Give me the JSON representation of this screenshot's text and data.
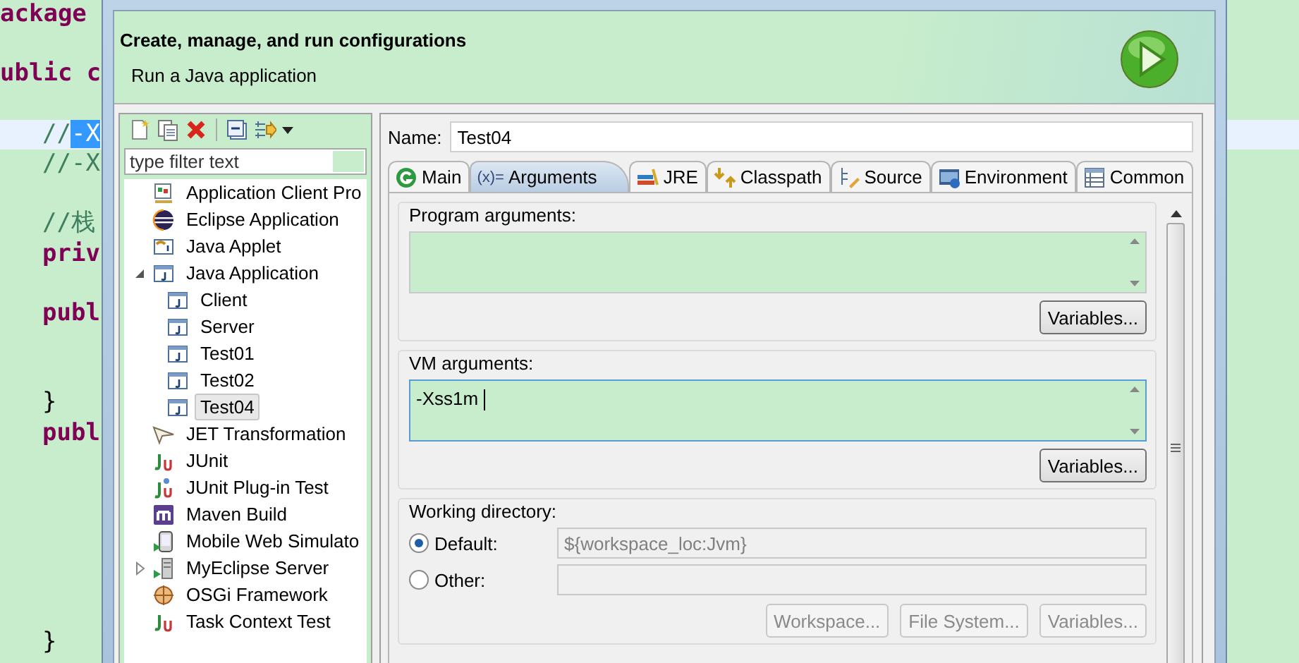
{
  "editor": {
    "lines": [
      {
        "segments": [
          {
            "text": "ackage",
            "kind": "keyword",
            "selected": false
          }
        ]
      },
      {
        "segments": [
          {
            "text": "ublic c",
            "kind": "keyword",
            "selected": false
          }
        ]
      },
      {
        "current": true,
        "segments": [
          {
            "text": "//",
            "kind": "comment",
            "selected": false
          },
          {
            "text": "-X",
            "kind": "comment",
            "selected": true
          }
        ]
      },
      {
        "segments": [
          {
            "text": "//-X",
            "kind": "comment",
            "selected": false
          }
        ]
      },
      {
        "segments": [
          {
            "text": "//栈",
            "kind": "comment",
            "selected": false
          }
        ]
      },
      {
        "segments": [
          {
            "text": "priv",
            "kind": "keyword",
            "selected": false
          }
        ]
      },
      {
        "segments": [
          {
            "text": "publ",
            "kind": "keyword",
            "selected": false
          }
        ]
      },
      {
        "segments": [
          {
            "text": "}",
            "kind": "plain",
            "selected": false
          }
        ]
      },
      {
        "segments": [
          {
            "text": "publ",
            "kind": "keyword",
            "selected": false
          }
        ]
      },
      {
        "segments": [
          {
            "text": "}",
            "kind": "plain",
            "selected": false
          }
        ]
      }
    ]
  },
  "dialog": {
    "title": "Create, manage, and run configurations",
    "subtitle": "Run a Java application",
    "filter": {
      "placeholder": "type filter text"
    },
    "tree": [
      {
        "label": "Application Client Pro"
      },
      {
        "label": "Eclipse Application"
      },
      {
        "label": "Java Applet"
      },
      {
        "label": "Java Application",
        "expanded": true,
        "children": [
          {
            "label": "Client",
            "selected": false
          },
          {
            "label": "Server",
            "selected": false
          },
          {
            "label": "Test01",
            "selected": false
          },
          {
            "label": "Test02",
            "selected": false
          },
          {
            "label": "Test04",
            "selected": true
          }
        ]
      },
      {
        "label": "JET Transformation"
      },
      {
        "label": "JUnit"
      },
      {
        "label": "JUnit Plug-in Test"
      },
      {
        "label": "Maven Build"
      },
      {
        "label": "Mobile Web Simulato"
      },
      {
        "label": "MyEclipse Server",
        "expanded": false
      },
      {
        "label": "OSGi Framework"
      },
      {
        "label": "Task Context Test"
      }
    ],
    "name_label": "Name:",
    "name_value": "Test04",
    "tabs": [
      {
        "label": "Main",
        "selected": false
      },
      {
        "label": "Arguments",
        "icon_text": "(x)=",
        "selected": true
      },
      {
        "label": "JRE",
        "selected": false
      },
      {
        "label": "Classpath",
        "selected": false
      },
      {
        "label": "Source",
        "selected": false
      },
      {
        "label": "Environment",
        "selected": false
      },
      {
        "label": "Common",
        "selected": false
      }
    ],
    "program_arguments": {
      "label": "Program arguments:",
      "button": "Variables..."
    },
    "vm_arguments": {
      "label": "VM arguments:",
      "value": "-Xss1m ",
      "focused": true,
      "button": "Variables..."
    },
    "working_directory": {
      "label": "Working directory:",
      "options": [
        {
          "label": "Default:",
          "value": "${workspace_loc:Jvm}",
          "selected": true
        },
        {
          "label": "Other:",
          "selected": false
        }
      ],
      "buttons": [
        {
          "label": "Workspace...",
          "disabled": true
        },
        {
          "label": "File System...",
          "disabled": true
        },
        {
          "label": "Variables...",
          "disabled": true
        }
      ]
    }
  }
}
